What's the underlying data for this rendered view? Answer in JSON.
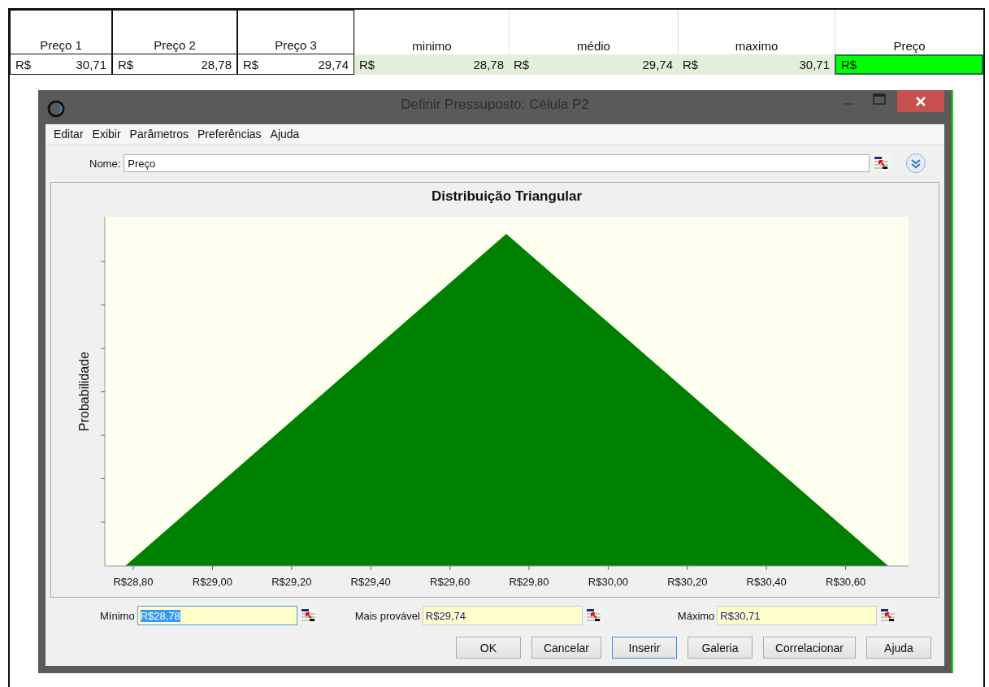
{
  "spreadsheet": {
    "columns": [
      {
        "header": "Preço 1",
        "currency": "R$",
        "value": "30,71",
        "kind": "bordered"
      },
      {
        "header": "Preço 2",
        "currency": "R$",
        "value": "28,78",
        "kind": "bordered"
      },
      {
        "header": "Preço 3",
        "currency": "R$",
        "value": "29,74",
        "kind": "bordered"
      },
      {
        "header": "minimo",
        "currency": "R$",
        "value": "28,78",
        "kind": "shaded"
      },
      {
        "header": "médio",
        "currency": "R$",
        "value": "29,74",
        "kind": "shaded"
      },
      {
        "header": "maximo",
        "currency": "R$",
        "value": "30,71",
        "kind": "shaded"
      },
      {
        "header": "Preço",
        "currency": "R$",
        "kind": "active"
      }
    ]
  },
  "dialog": {
    "title": "Definir Pressuposto: Célula P2",
    "menu": [
      "Editar",
      "Exibir",
      "Parâmetros",
      "Preferências",
      "Ajuda"
    ],
    "name_label": "Nome:",
    "name_value": "Preço",
    "chart": {
      "title": "Distribuição Triangular",
      "ylabel": "Probabilidade",
      "xtick_labels": [
        "R$28,80",
        "R$29,00",
        "R$29,20",
        "R$29,40",
        "R$29,60",
        "R$29,80",
        "R$30,00",
        "R$30,20",
        "R$30,40",
        "R$30,60"
      ]
    },
    "params": [
      {
        "label": "Mínimo",
        "value": "R$28,78",
        "focused": true
      },
      {
        "label": "Mais provável",
        "value": "R$29,74",
        "focused": false
      },
      {
        "label": "Máximo",
        "value": "R$30,71",
        "focused": false
      }
    ],
    "buttons": [
      {
        "label": "OK",
        "default": false
      },
      {
        "label": "Cancelar",
        "default": false
      },
      {
        "label": "Inserir",
        "default": true
      },
      {
        "label": "Galeria",
        "default": false
      },
      {
        "label": "Correlacionar",
        "default": false
      },
      {
        "label": "Ajuda",
        "default": false
      }
    ]
  }
}
